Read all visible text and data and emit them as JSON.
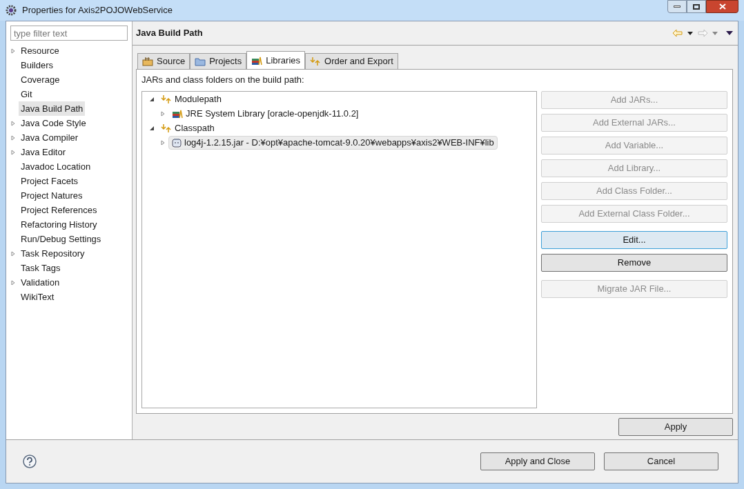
{
  "window": {
    "title": "Properties for Axis2POJOWebService"
  },
  "sidebar": {
    "filter": {
      "placeholder": "type filter text"
    },
    "items": [
      {
        "label": "Resource",
        "expandable": true,
        "selected": false
      },
      {
        "label": "Builders",
        "expandable": false,
        "selected": false
      },
      {
        "label": "Coverage",
        "expandable": false,
        "selected": false
      },
      {
        "label": "Git",
        "expandable": false,
        "selected": false
      },
      {
        "label": "Java Build Path",
        "expandable": false,
        "selected": true
      },
      {
        "label": "Java Code Style",
        "expandable": true,
        "selected": false
      },
      {
        "label": "Java Compiler",
        "expandable": true,
        "selected": false
      },
      {
        "label": "Java Editor",
        "expandable": true,
        "selected": false
      },
      {
        "label": "Javadoc Location",
        "expandable": false,
        "selected": false
      },
      {
        "label": "Project Facets",
        "expandable": false,
        "selected": false
      },
      {
        "label": "Project Natures",
        "expandable": false,
        "selected": false
      },
      {
        "label": "Project References",
        "expandable": false,
        "selected": false
      },
      {
        "label": "Refactoring History",
        "expandable": false,
        "selected": false
      },
      {
        "label": "Run/Debug Settings",
        "expandable": false,
        "selected": false
      },
      {
        "label": "Task Repository",
        "expandable": true,
        "selected": false
      },
      {
        "label": "Task Tags",
        "expandable": false,
        "selected": false
      },
      {
        "label": "Validation",
        "expandable": true,
        "selected": false
      },
      {
        "label": "WikiText",
        "expandable": false,
        "selected": false
      }
    ]
  },
  "page": {
    "title": "Java Build Path",
    "tabs": [
      {
        "label": "Source",
        "kind": "source",
        "selected": false
      },
      {
        "label": "Projects",
        "kind": "projects",
        "selected": false
      },
      {
        "label": "Libraries",
        "kind": "libraries",
        "selected": true
      },
      {
        "label": "Order and Export",
        "kind": "order",
        "selected": false
      }
    ],
    "caption": "JARs and class folders on the build path:",
    "tree": [
      {
        "label": "Modulepath",
        "kind": "container",
        "expanded": true,
        "selected": false,
        "children": [
          {
            "label": "JRE System Library [oracle-openjdk-11.0.2]",
            "kind": "library",
            "expanded": false,
            "selected": false
          }
        ]
      },
      {
        "label": "Classpath",
        "kind": "container",
        "expanded": true,
        "selected": false,
        "children": [
          {
            "label": "log4j-1.2.15.jar - D:¥opt¥apache-tomcat-9.0.20¥webapps¥axis2¥WEB-INF¥lib",
            "kind": "jar",
            "expanded": false,
            "selected": true
          }
        ]
      }
    ],
    "button_groups": [
      [
        {
          "label": "Add JARs...",
          "disabled": true,
          "focused": false
        },
        {
          "label": "Add External JARs...",
          "disabled": true,
          "focused": false
        },
        {
          "label": "Add Variable...",
          "disabled": true,
          "focused": false
        },
        {
          "label": "Add Library...",
          "disabled": true,
          "focused": false
        },
        {
          "label": "Add Class Folder...",
          "disabled": true,
          "focused": false
        },
        {
          "label": "Add External Class Folder...",
          "disabled": true,
          "focused": false
        }
      ],
      [
        {
          "label": "Edit...",
          "disabled": false,
          "focused": true
        },
        {
          "label": "Remove",
          "disabled": false,
          "focused": false
        }
      ],
      [
        {
          "label": "Migrate JAR File...",
          "disabled": true,
          "focused": false
        }
      ]
    ],
    "apply": "Apply"
  },
  "footer": {
    "buttons": [
      "Apply and Close",
      "Cancel"
    ]
  }
}
